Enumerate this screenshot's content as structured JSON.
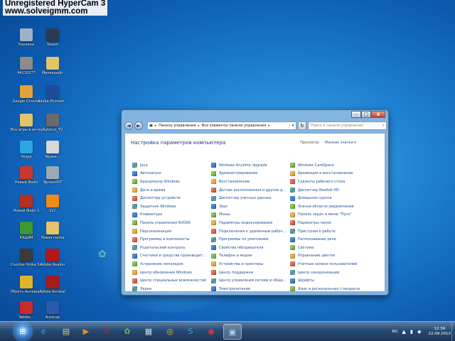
{
  "watermark": {
    "line1": "Unregistered HyperCam 3",
    "line2": "www.solveigmm.com"
  },
  "desktop_icons": [
    {
      "label": "Корзина",
      "color": "#9fb3c8"
    },
    {
      "label": "Steam",
      "color": "#2a3a52"
    },
    {
      "label": "44130277",
      "color": "#8c8c8c"
    },
    {
      "label": "Минекрафт",
      "color": "#e2c56a"
    },
    {
      "label": "Google Chrome",
      "color": "#e4a23a"
    },
    {
      "label": "Adobe Photosh...",
      "color": "#1c4d9a"
    },
    {
      "label": "Все игры в интернете",
      "color": "#e2c56a"
    },
    {
      "label": "Autorun_TV",
      "color": "#6a6a6a"
    },
    {
      "label": "Skype",
      "color": "#2aa7e2"
    },
    {
      "label": "Ярлык...",
      "color": "#d8d8d8"
    },
    {
      "label": "Новый Файл",
      "color": "#c9382a"
    },
    {
      "label": "Ярлык007",
      "color": "#9aa8b8"
    },
    {
      "label": "Новый Файл 1",
      "color": "#b23022"
    },
    {
      "label": "VLC",
      "color": "#f08a1a"
    },
    {
      "label": "ЮЩИМ",
      "color": "#3c9a2e"
    },
    {
      "label": "Новая папка",
      "color": "#e2c56a"
    },
    {
      "label": "Counter-Strike Source",
      "color": "#3a3a3a"
    },
    {
      "label": "Adobe Reader",
      "color": "#b01818"
    },
    {
      "label": "Убрать Антивирус",
      "color": "#e0b42a"
    },
    {
      "label": "Adobe Acrobat",
      "color": "#a51a1a"
    },
    {
      "label": "Adobe...",
      "color": "#c82a2a"
    },
    {
      "label": "Autocap",
      "color": "#2b5aa8"
    }
  ],
  "window": {
    "controls": {
      "minimize": "–",
      "maximize": "□",
      "close": "x"
    },
    "nav": {
      "back": "◄",
      "forward": "►",
      "refresh": "↻",
      "dropdown": "▾"
    },
    "address": [
      "Панель управления",
      "Все элементы панели управления"
    ],
    "search_placeholder": "Поиск в панели управления",
    "search_icon": "search-icon",
    "title": "Настройка параметров компьютера",
    "view_by_label": "Просмотр:",
    "view_by_value": "Мелкие значки ▾",
    "items": [
      [
        "Java",
        "Автозапуск",
        "Брандмауэр Windows",
        "Дата и время",
        "Диспетчер устройств",
        "Защитник Windows",
        "Клавиатура",
        "Панель управления NVIDIA",
        "Персонализация",
        "Программы и компоненты",
        "Родительский контроль",
        "Счетчики и средства производит...",
        "Устранение неполадок",
        "Центр обновления Windows",
        "Центр специальных возможностей",
        "Экран"
      ],
      [
        "Windows Anytime Upgrade",
        "Администрирование",
        "Восстановление",
        "Датчик расположения и другие д...",
        "Диспетчер учетных данных",
        "Звук",
        "Мышь",
        "Параметры индексирования",
        "Подключения к удаленным рабоч...",
        "Программы по умолчанию",
        "Свойства обозревателя",
        "Телефон и модем",
        "Устройства и принтеры",
        "Центр поддержки",
        "Центр управления сетями и обще...",
        "Электропитание"
      ],
      [
        "Windows CardSpace",
        "Архивация и восстановление",
        "Гаджеты рабочего стола",
        "Диспетчер Realtek HD",
        "Домашняя группа",
        "Значки области уведомлений",
        "Панель задач и меню \"Пуск\"",
        "Параметры папок",
        "Приступая к работе",
        "Распознавание речи",
        "Система",
        "Управление цветом",
        "Учетные записи пользователей",
        "Центр синхронизации",
        "Шрифты",
        "Язык и региональные стандарты"
      ]
    ]
  },
  "taskbar": {
    "start_icon": "windows-orb-icon",
    "buttons": [
      {
        "name": "ie-icon",
        "glyph": "e",
        "color": "#3a9be8"
      },
      {
        "name": "explorer-icon",
        "glyph": "▤",
        "color": "#e7c86a"
      },
      {
        "name": "media-player-icon",
        "glyph": "▶",
        "color": "#f08a1a"
      },
      {
        "name": "adobe-icon",
        "glyph": "A",
        "color": "#c81e1e"
      },
      {
        "name": "app-icon",
        "glyph": "✿",
        "color": "#6bbf3a"
      },
      {
        "name": "calculator-icon",
        "glyph": "▦",
        "color": "#cfd8e2"
      },
      {
        "name": "chrome-icon",
        "glyph": "◎",
        "color": "#e9b43a"
      },
      {
        "name": "skype-icon",
        "glyph": "S",
        "color": "#1fa7e8"
      },
      {
        "name": "opera-icon",
        "glyph": "◉",
        "color": "#e23a3a"
      },
      {
        "name": "control-panel-icon",
        "glyph": "▣",
        "color": "#9fd2f5"
      }
    ],
    "lang": "RU",
    "tray_icons": "▲ ▮ ◆",
    "time": "12:39",
    "date": "22.09.2012"
  }
}
